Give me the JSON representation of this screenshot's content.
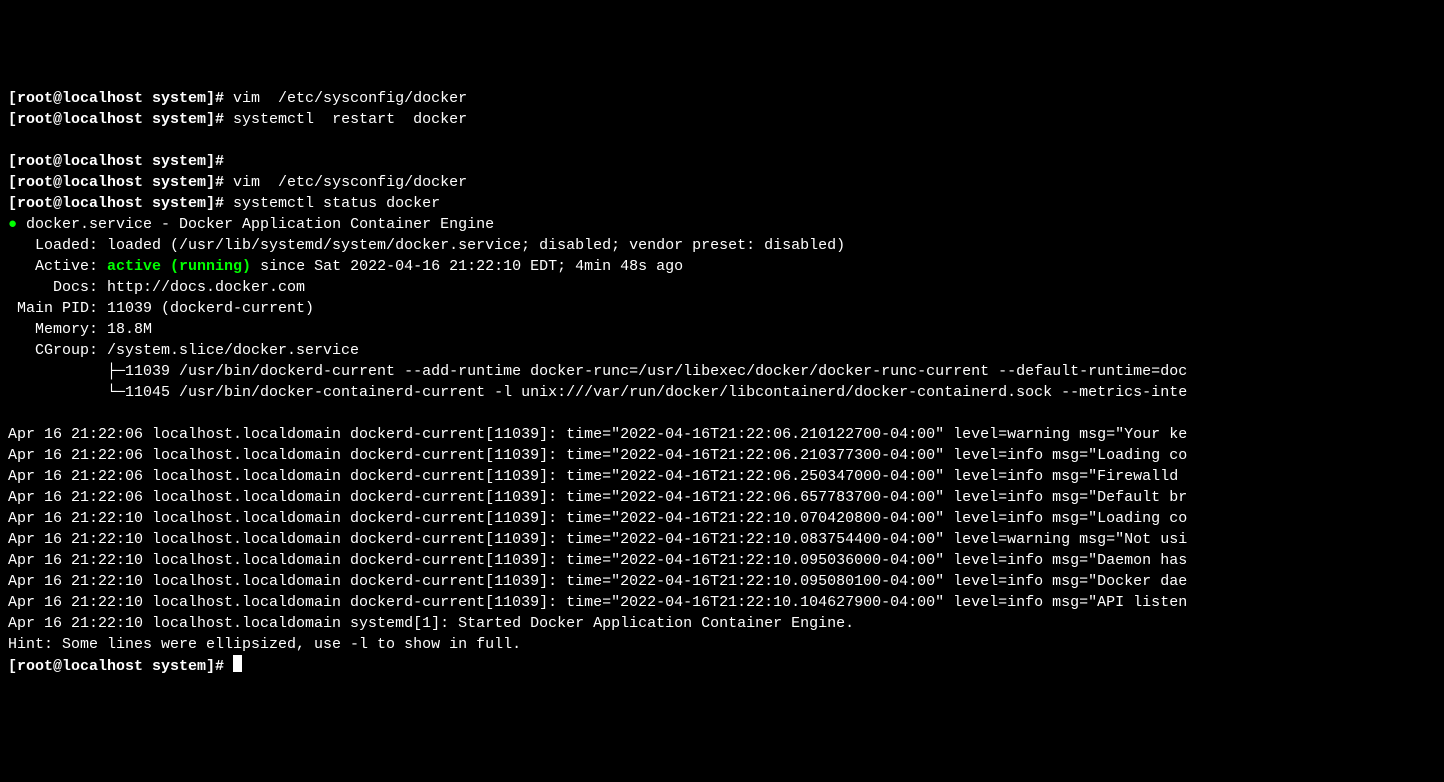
{
  "prompt": "[root@localhost system]# ",
  "cmds": {
    "c1": "vim  /etc/sysconfig/docker",
    "c2": "systemctl  restart  docker",
    "c3": "",
    "c4": "vim  /etc/sysconfig/docker",
    "c5": "systemctl status docker"
  },
  "status": {
    "unit_line": "docker.service - Docker Application Container Engine",
    "loaded": "   Loaded: loaded (/usr/lib/systemd/system/docker.service; disabled; vendor preset: disabled)",
    "active_pre": "   Active: ",
    "active_state": "active (running)",
    "active_post": " since Sat 2022-04-16 21:22:10 EDT; 4min 48s ago",
    "docs": "     Docs: http://docs.docker.com",
    "mainpid": " Main PID: 11039 (dockerd-current)",
    "memory": "   Memory: 18.8M",
    "cgroup": "   CGroup: /system.slice/docker.service",
    "cg1": "           ├─11039 /usr/bin/dockerd-current --add-runtime docker-runc=/usr/libexec/docker/docker-runc-current --default-runtime=doc",
    "cg2": "           └─11045 /usr/bin/docker-containerd-current -l unix:///var/run/docker/libcontainerd/docker-containerd.sock --metrics-inte"
  },
  "logs": {
    "l1": "Apr 16 21:22:06 localhost.localdomain dockerd-current[11039]: time=\"2022-04-16T21:22:06.210122700-04:00\" level=warning msg=\"Your ke",
    "l2": "Apr 16 21:22:06 localhost.localdomain dockerd-current[11039]: time=\"2022-04-16T21:22:06.210377300-04:00\" level=info msg=\"Loading co",
    "l3": "Apr 16 21:22:06 localhost.localdomain dockerd-current[11039]: time=\"2022-04-16T21:22:06.250347000-04:00\" level=info msg=\"Firewalld ",
    "l4": "Apr 16 21:22:06 localhost.localdomain dockerd-current[11039]: time=\"2022-04-16T21:22:06.657783700-04:00\" level=info msg=\"Default br",
    "l5": "Apr 16 21:22:10 localhost.localdomain dockerd-current[11039]: time=\"2022-04-16T21:22:10.070420800-04:00\" level=info msg=\"Loading co",
    "l6": "Apr 16 21:22:10 localhost.localdomain dockerd-current[11039]: time=\"2022-04-16T21:22:10.083754400-04:00\" level=warning msg=\"Not usi",
    "l7": "Apr 16 21:22:10 localhost.localdomain dockerd-current[11039]: time=\"2022-04-16T21:22:10.095036000-04:00\" level=info msg=\"Daemon has",
    "l8": "Apr 16 21:22:10 localhost.localdomain dockerd-current[11039]: time=\"2022-04-16T21:22:10.095080100-04:00\" level=info msg=\"Docker dae",
    "l9": "Apr 16 21:22:10 localhost.localdomain dockerd-current[11039]: time=\"2022-04-16T21:22:10.104627900-04:00\" level=info msg=\"API listen",
    "l10": "Apr 16 21:22:10 localhost.localdomain systemd[1]: Started Docker Application Container Engine."
  },
  "hint": "Hint: Some lines were ellipsized, use -l to show in full."
}
